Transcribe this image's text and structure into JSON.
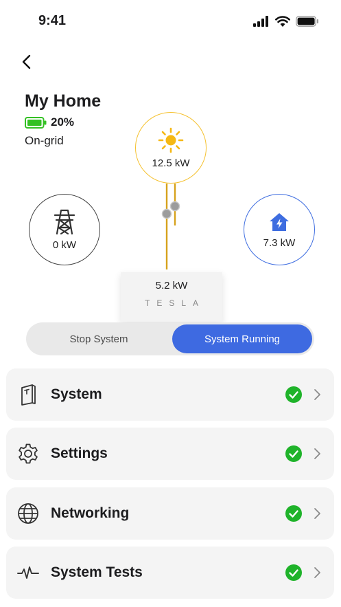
{
  "status_bar": {
    "time": "9:41"
  },
  "home": {
    "title": "My Home",
    "battery_percent": "20%",
    "battery_level": 0.2,
    "grid_status": "On-grid"
  },
  "energy_flow": {
    "solar_power": "12.5 kW",
    "grid_power": "0 kW",
    "home_power": "7.3 kW",
    "gateway_power": "5.2 kW",
    "gateway_logo": "TESLA"
  },
  "toggle": {
    "stop_label": "Stop System",
    "running_label": "System Running",
    "active": "running"
  },
  "menu": {
    "items": [
      {
        "label": "System",
        "icon": "powerwall-icon",
        "status": "ok"
      },
      {
        "label": "Settings",
        "icon": "gear-icon",
        "status": "ok"
      },
      {
        "label": "Networking",
        "icon": "globe-icon",
        "status": "ok"
      },
      {
        "label": "System Tests",
        "icon": "pulse-icon",
        "status": "ok"
      }
    ]
  },
  "colors": {
    "solar": "#f5c12e",
    "home": "#3e6de0",
    "accent": "#3e6ae1",
    "ok": "#1fb32a",
    "battery": "#34c124"
  }
}
